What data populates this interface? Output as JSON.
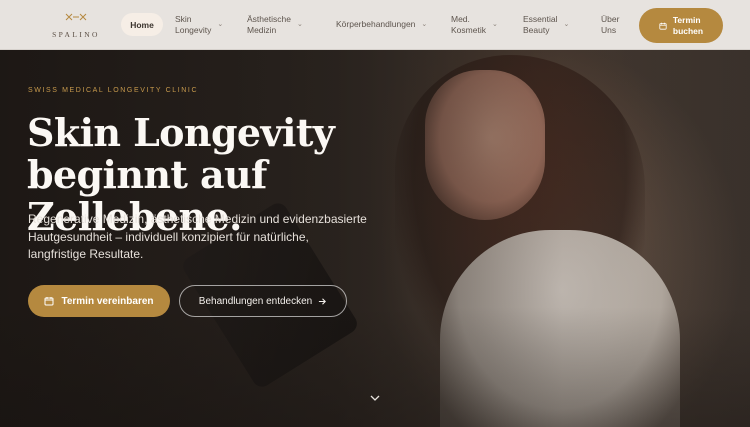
{
  "header": {
    "logo_text": "SPALINO",
    "nav": {
      "home": "Home",
      "skin_longevity": [
        "Skin",
        "Longevity"
      ],
      "aesthetic": [
        "Ästhetische",
        "Medizin"
      ],
      "body": "Körperbehandlungen",
      "med_cosmetic": [
        "Med.",
        "Kosmetik"
      ],
      "essential": [
        "Essential",
        "Beauty"
      ],
      "about": [
        "Über",
        "Uns"
      ]
    },
    "cta_label": [
      "Termin",
      "buchen"
    ]
  },
  "hero": {
    "eyebrow": "SWISS MEDICAL LONGEVITY CLINIC",
    "headline_line1": "Skin Longevity",
    "headline_line2": "beginnt auf Zellebene.",
    "subtext": "Regenerative Medizin, ästhetische Medizin und evidenzbasierte Hautgesundheit – individuell konzipiert für natürliche, langfristige Resultate.",
    "primary_button": "Termin vereinbaren",
    "secondary_button": "Behandlungen entdecken"
  },
  "colors": {
    "accent": "#b5893f",
    "header_bg": "#e7e3df",
    "eyebrow": "#c79a4d"
  },
  "icons": {
    "calendar": "calendar-icon",
    "arrow": "arrow-right-icon",
    "chevron": "chevron-down-icon"
  }
}
